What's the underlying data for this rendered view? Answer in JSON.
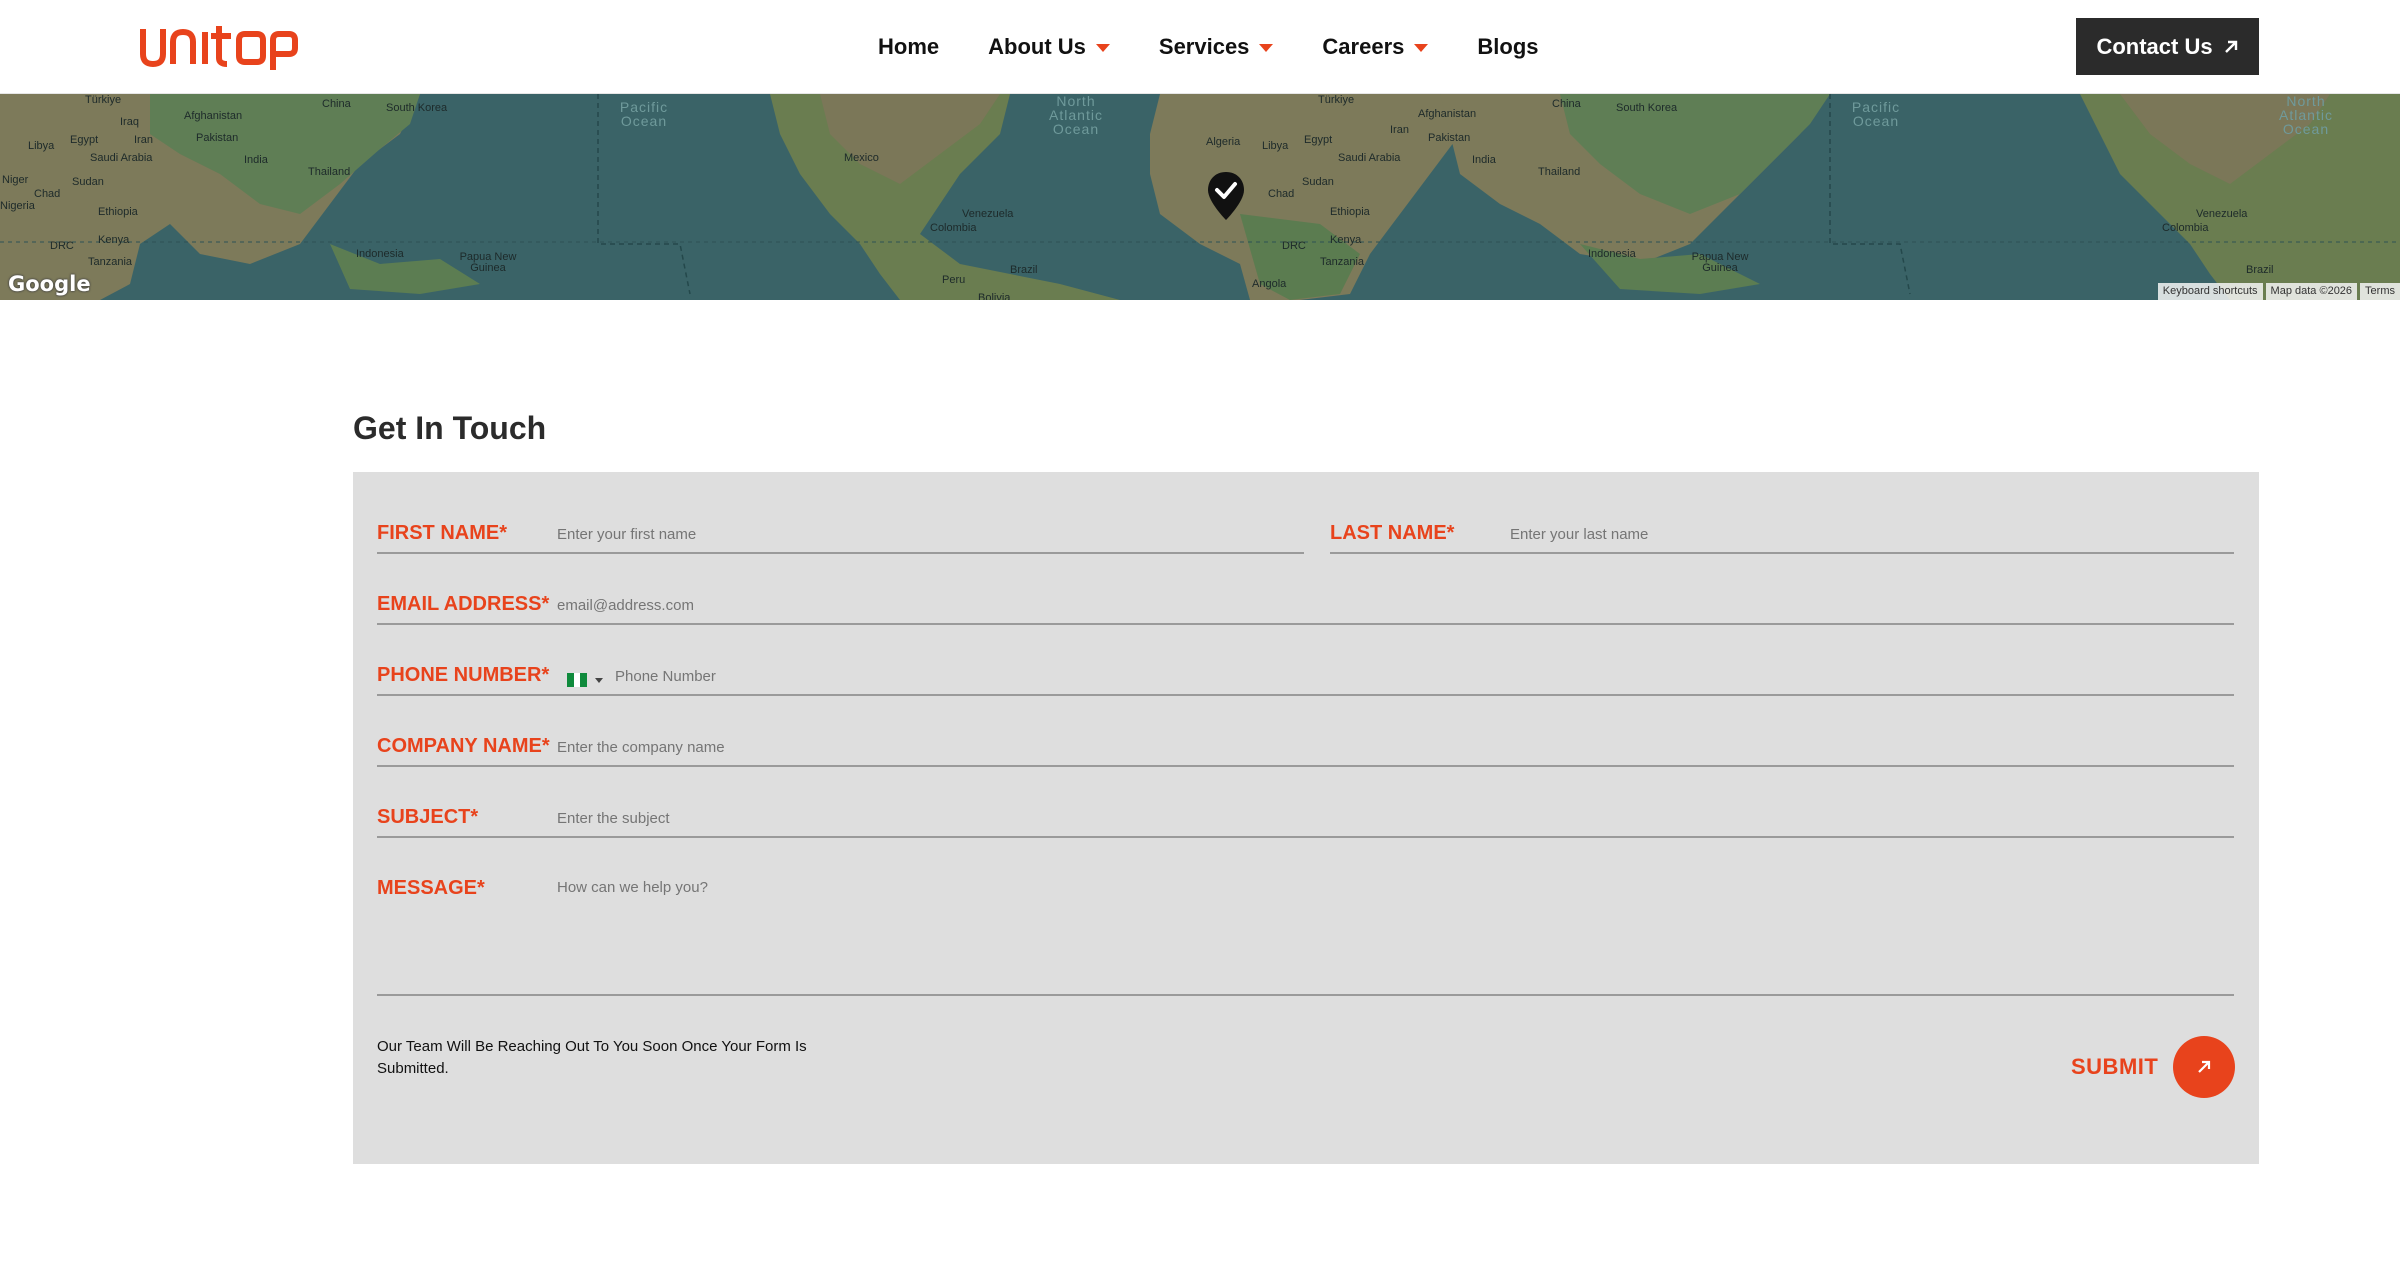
{
  "header": {
    "logo_text": "unitop",
    "nav": [
      {
        "label": "Home",
        "has_dropdown": false
      },
      {
        "label": "About Us",
        "has_dropdown": true
      },
      {
        "label": "Services",
        "has_dropdown": true
      },
      {
        "label": "Careers",
        "has_dropdown": true
      },
      {
        "label": "Blogs",
        "has_dropdown": false
      }
    ],
    "contact_button": "Contact Us"
  },
  "map": {
    "labels": [
      "Türkiye",
      "Iraq",
      "Afghanistan",
      "China",
      "South Korea",
      "Libya",
      "Egypt",
      "Iran",
      "Pakistan",
      "Saudi Arabia",
      "India",
      "Thailand",
      "Niger",
      "Chad",
      "Sudan",
      "Nigeria",
      "Ethiopia",
      "DRC",
      "Kenya",
      "Tanzania",
      "Indonesia",
      "Papua New Guinea",
      "Mexico",
      "Venezuela",
      "Colombia",
      "Peru",
      "Brazil",
      "Algeria",
      "Angola",
      "Bolivia"
    ],
    "oceans": [
      "Pacific Ocean",
      "North Atlantic Ocean"
    ],
    "google_logo": "Google",
    "footer": [
      "Keyboard shortcuts",
      "Map data ©2026",
      "Terms"
    ]
  },
  "contact": {
    "title": "Get In Touch",
    "fields": {
      "first_name": {
        "label": "FIRST NAME*",
        "placeholder": "Enter your first name"
      },
      "last_name": {
        "label": "LAST NAME*",
        "placeholder": "Enter your last name"
      },
      "email": {
        "label": "EMAIL ADDRESS*",
        "placeholder": "email@address.com"
      },
      "phone": {
        "label": "PHONE NUMBER*",
        "placeholder": "Phone Number"
      },
      "company": {
        "label": "COMPANY NAME*",
        "placeholder": "Enter the company name"
      },
      "subject": {
        "label": "SUBJECT*",
        "placeholder": "Enter the subject"
      },
      "message": {
        "label": "MESSAGE*",
        "placeholder": "How can we help you?"
      }
    },
    "footnote": "Our Team Will Be Reaching Out To You Soon Once Your Form Is Submitted.",
    "submit": "SUBMIT"
  },
  "colors": {
    "accent": "#e8431c",
    "dark_button": "#2b2b2b",
    "form_bg": "#dedede",
    "map_water": "#3a6367"
  }
}
